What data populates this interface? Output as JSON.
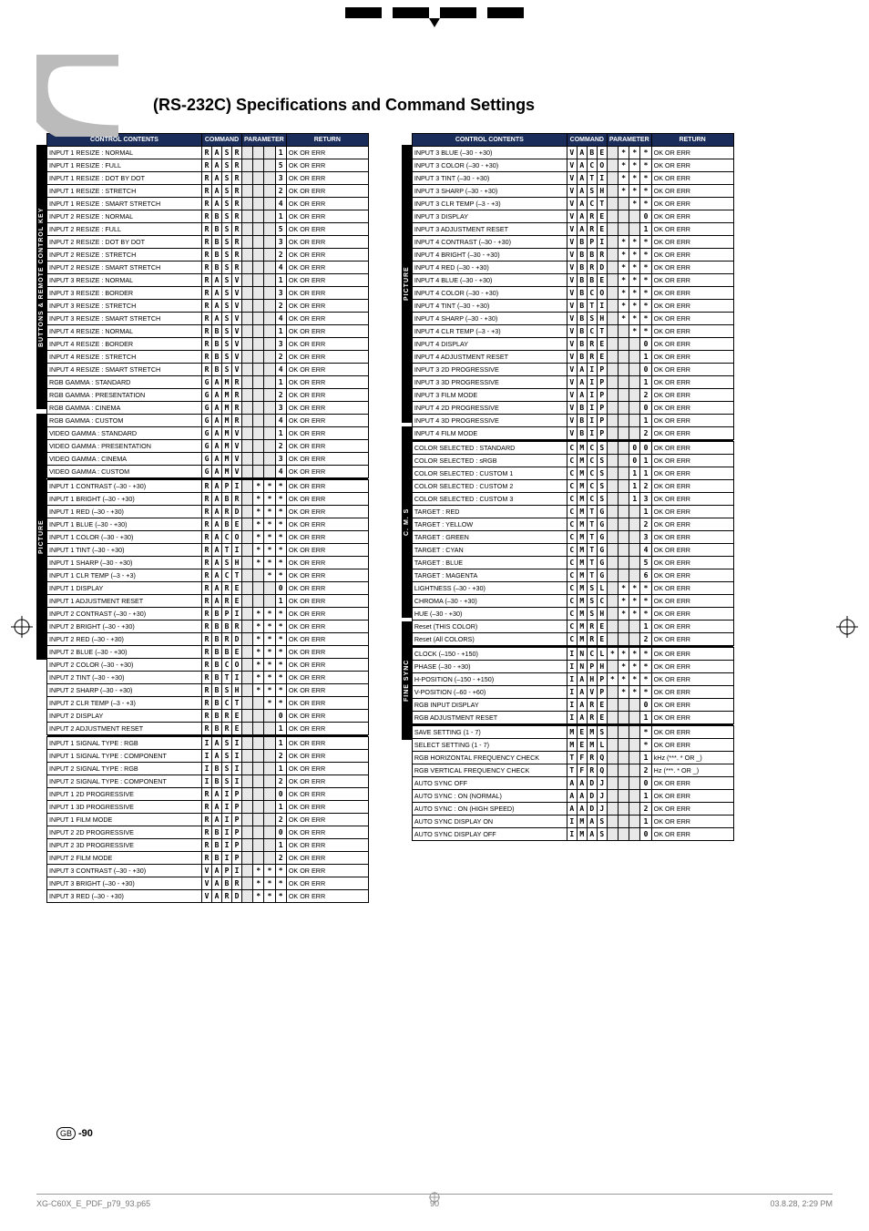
{
  "title": "(RS-232C) Specifications and Command Settings",
  "page_num": "-90",
  "gb": "GB",
  "footer_file": "XG-C60X_E_PDF_p79_93.p65",
  "footer_page": "90",
  "footer_date": "03.8.28, 2:29 PM",
  "hdr": {
    "control": "CONTROL CONTENTS",
    "command": "COMMAND",
    "param": "PARAMETER",
    "return": "RETURN"
  },
  "vlabels": {
    "l1": "BUTTONS & REMOTE CONTROL KEY",
    "l2a": "PICTURE",
    "l2b": "C. M. S",
    "l2c": "FINE SYNC",
    "l2d": ""
  },
  "table1": [
    [
      "INPUT 1 RESIZE : NORMAL",
      "R",
      "A",
      "S",
      "R",
      "_",
      "_",
      "_",
      "1",
      "OK OR ERR"
    ],
    [
      "INPUT 1 RESIZE : FULL",
      "R",
      "A",
      "S",
      "R",
      "_",
      "_",
      "_",
      "5",
      "OK OR ERR"
    ],
    [
      "INPUT 1 RESIZE : DOT BY DOT",
      "R",
      "A",
      "S",
      "R",
      "_",
      "_",
      "_",
      "3",
      "OK OR ERR"
    ],
    [
      "INPUT 1 RESIZE : STRETCH",
      "R",
      "A",
      "S",
      "R",
      "_",
      "_",
      "_",
      "2",
      "OK OR ERR"
    ],
    [
      "INPUT 1 RESIZE : SMART STRETCH",
      "R",
      "A",
      "S",
      "R",
      "_",
      "_",
      "_",
      "4",
      "OK OR ERR"
    ],
    [
      "INPUT 2 RESIZE : NORMAL",
      "R",
      "B",
      "S",
      "R",
      "_",
      "_",
      "_",
      "1",
      "OK OR ERR"
    ],
    [
      "INPUT 2 RESIZE : FULL",
      "R",
      "B",
      "S",
      "R",
      "_",
      "_",
      "_",
      "5",
      "OK OR ERR"
    ],
    [
      "INPUT 2 RESIZE : DOT BY DOT",
      "R",
      "B",
      "S",
      "R",
      "_",
      "_",
      "_",
      "3",
      "OK OR ERR"
    ],
    [
      "INPUT 2 RESIZE : STRETCH",
      "R",
      "B",
      "S",
      "R",
      "_",
      "_",
      "_",
      "2",
      "OK OR ERR"
    ],
    [
      "INPUT 2 RESIZE : SMART STRETCH",
      "R",
      "B",
      "S",
      "R",
      "_",
      "_",
      "_",
      "4",
      "OK OR ERR"
    ],
    [
      "INPUT 3 RESIZE : NORMAL",
      "R",
      "A",
      "S",
      "V",
      "_",
      "_",
      "_",
      "1",
      "OK OR ERR"
    ],
    [
      "INPUT 3 RESIZE : BORDER",
      "R",
      "A",
      "S",
      "V",
      "_",
      "_",
      "_",
      "3",
      "OK OR ERR"
    ],
    [
      "INPUT 3 RESIZE : STRETCH",
      "R",
      "A",
      "S",
      "V",
      "_",
      "_",
      "_",
      "2",
      "OK OR ERR"
    ],
    [
      "INPUT 3 RESIZE : SMART STRETCH",
      "R",
      "A",
      "S",
      "V",
      "_",
      "_",
      "_",
      "4",
      "OK OR ERR"
    ],
    [
      "INPUT 4 RESIZE : NORMAL",
      "R",
      "B",
      "S",
      "V",
      "_",
      "_",
      "_",
      "1",
      "OK OR ERR"
    ],
    [
      "INPUT 4 RESIZE : BORDER",
      "R",
      "B",
      "S",
      "V",
      "_",
      "_",
      "_",
      "3",
      "OK OR ERR"
    ],
    [
      "INPUT 4 RESIZE : STRETCH",
      "R",
      "B",
      "S",
      "V",
      "_",
      "_",
      "_",
      "2",
      "OK OR ERR"
    ],
    [
      "INPUT 4 RESIZE : SMART STRETCH",
      "R",
      "B",
      "S",
      "V",
      "_",
      "_",
      "_",
      "4",
      "OK OR ERR"
    ],
    [
      "RGB GAMMA : STANDARD",
      "G",
      "A",
      "M",
      "R",
      "_",
      "_",
      "_",
      "1",
      "OK OR ERR"
    ],
    [
      "RGB GAMMA : PRESENTATION",
      "G",
      "A",
      "M",
      "R",
      "_",
      "_",
      "_",
      "2",
      "OK OR ERR"
    ],
    [
      "RGB GAMMA : CINEMA",
      "G",
      "A",
      "M",
      "R",
      "_",
      "_",
      "_",
      "3",
      "OK OR ERR"
    ],
    [
      "RGB GAMMA : CUSTOM",
      "G",
      "A",
      "M",
      "R",
      "_",
      "_",
      "_",
      "4",
      "OK OR ERR"
    ],
    [
      "VIDEO GAMMA : STANDARD",
      "G",
      "A",
      "M",
      "V",
      "_",
      "_",
      "_",
      "1",
      "OK OR ERR"
    ],
    [
      "VIDEO GAMMA : PRESENTATION",
      "G",
      "A",
      "M",
      "V",
      "_",
      "_",
      "_",
      "2",
      "OK OR ERR"
    ],
    [
      "VIDEO GAMMA : CINEMA",
      "G",
      "A",
      "M",
      "V",
      "_",
      "_",
      "_",
      "3",
      "OK OR ERR"
    ],
    [
      "VIDEO GAMMA : CUSTOM",
      "G",
      "A",
      "M",
      "V",
      "_",
      "_",
      "_",
      "4",
      "OK OR ERR"
    ],
    [
      "INPUT 1 CONTRAST (–30 - +30)",
      "R",
      "A",
      "P",
      "I",
      "_",
      "*",
      "*",
      "*",
      "OK OR ERR"
    ],
    [
      "INPUT 1 BRIGHT (–30 - +30)",
      "R",
      "A",
      "B",
      "R",
      "_",
      "*",
      "*",
      "*",
      "OK OR ERR"
    ],
    [
      "INPUT 1 RED  (–30 - +30)",
      "R",
      "A",
      "R",
      "D",
      "_",
      "*",
      "*",
      "*",
      "OK OR ERR"
    ],
    [
      "INPUT 1 BLUE (–30 - +30)",
      "R",
      "A",
      "B",
      "E",
      "_",
      "*",
      "*",
      "*",
      "OK OR ERR"
    ],
    [
      "INPUT 1 COLOR  (–30 - +30)",
      "R",
      "A",
      "C",
      "O",
      "_",
      "*",
      "*",
      "*",
      "OK OR ERR"
    ],
    [
      "INPUT 1 TINT (–30 - +30)",
      "R",
      "A",
      "T",
      "I",
      "_",
      "*",
      "*",
      "*",
      "OK OR ERR"
    ],
    [
      "INPUT 1 SHARP (–30 - +30)",
      "R",
      "A",
      "S",
      "H",
      "_",
      "*",
      "*",
      "*",
      "OK OR ERR"
    ],
    [
      "INPUT 1 CLR TEMP (–3 - +3)",
      "R",
      "A",
      "C",
      "T",
      "_",
      "_",
      "*",
      "*",
      "OK OR ERR"
    ],
    [
      "INPUT 1 DISPLAY",
      "R",
      "A",
      "R",
      "E",
      "_",
      "_",
      "_",
      "0",
      "OK OR ERR"
    ],
    [
      "INPUT 1 ADJUSTMENT RESET",
      "R",
      "A",
      "R",
      "E",
      "_",
      "_",
      "_",
      "1",
      "OK OR ERR"
    ],
    [
      "INPUT 2 CONTRAST  (–30 - +30)",
      "R",
      "B",
      "P",
      "I",
      "_",
      "*",
      "*",
      "*",
      "OK OR ERR"
    ],
    [
      "INPUT 2 BRIGHT (–30 - +30)",
      "R",
      "B",
      "B",
      "R",
      "_",
      "*",
      "*",
      "*",
      "OK OR ERR"
    ],
    [
      "INPUT 2 RED (–30 - +30)",
      "R",
      "B",
      "R",
      "D",
      "_",
      "*",
      "*",
      "*",
      "OK OR ERR"
    ],
    [
      "INPUT 2 BLUE (–30 - +30)",
      "R",
      "B",
      "B",
      "E",
      "_",
      "*",
      "*",
      "*",
      "OK OR ERR"
    ],
    [
      "INPUT 2 COLOR (–30 - +30)",
      "R",
      "B",
      "C",
      "O",
      "_",
      "*",
      "*",
      "*",
      "OK OR ERR"
    ],
    [
      "INPUT 2 TINT (–30 - +30)",
      "R",
      "B",
      "T",
      "I",
      "_",
      "*",
      "*",
      "*",
      "OK OR ERR"
    ],
    [
      "INPUT 2 SHARP (–30 - +30)",
      "R",
      "B",
      "S",
      "H",
      "_",
      "*",
      "*",
      "*",
      "OK OR ERR"
    ],
    [
      "INPUT 2 CLR TEMP (–3 - +3)",
      "R",
      "B",
      "C",
      "T",
      "_",
      "_",
      "*",
      "*",
      "OK OR ERR"
    ],
    [
      "INPUT 2 DISPLAY",
      "R",
      "B",
      "R",
      "E",
      "_",
      "_",
      "_",
      "0",
      "OK OR ERR"
    ],
    [
      "INPUT 2 ADJUSTMENT RESET",
      "R",
      "B",
      "R",
      "E",
      "_",
      "_",
      "_",
      "1",
      "OK OR ERR"
    ],
    [
      "INPUT 1 SIGNAL TYPE : RGB",
      "I",
      "A",
      "S",
      "I",
      "_",
      "_",
      "_",
      "1",
      "OK OR ERR"
    ],
    [
      "INPUT 1 SIGNAL TYPE : COMPONENT",
      "I",
      "A",
      "S",
      "I",
      "_",
      "_",
      "_",
      "2",
      "OK OR ERR"
    ],
    [
      "INPUT 2 SIGNAL TYPE : RGB",
      "I",
      "B",
      "S",
      "I",
      "_",
      "_",
      "_",
      "1",
      "OK OR ERR"
    ],
    [
      "INPUT 2 SIGNAL TYPE : COMPONENT",
      "I",
      "B",
      "S",
      "I",
      "_",
      "_",
      "_",
      "2",
      "OK OR ERR"
    ],
    [
      "INPUT 1 2D PROGRESSIVE",
      "R",
      "A",
      "I",
      "P",
      "_",
      "_",
      "_",
      "0",
      "OK OR ERR"
    ],
    [
      "INPUT 1 3D PROGRESSIVE",
      "R",
      "A",
      "I",
      "P",
      "_",
      "_",
      "_",
      "1",
      "OK OR ERR"
    ],
    [
      "INPUT 1 FILM MODE",
      "R",
      "A",
      "I",
      "P",
      "_",
      "_",
      "_",
      "2",
      "OK OR ERR"
    ],
    [
      "INPUT 2 2D PROGRESSIVE",
      "R",
      "B",
      "I",
      "P",
      "_",
      "_",
      "_",
      "0",
      "OK OR ERR"
    ],
    [
      "INPUT 2 3D PROGRESSIVE",
      "R",
      "B",
      "I",
      "P",
      "_",
      "_",
      "_",
      "1",
      "OK OR ERR"
    ],
    [
      "INPUT 2 FILM MODE",
      "R",
      "B",
      "I",
      "P",
      "_",
      "_",
      "_",
      "2",
      "OK OR ERR"
    ],
    [
      "INPUT 3 CONTRAST (–30 - +30)",
      "V",
      "A",
      "P",
      "I",
      "_",
      "*",
      "*",
      "*",
      "OK OR ERR"
    ],
    [
      "INPUT 3 BRIGHT (–30 - +30)",
      "V",
      "A",
      "B",
      "R",
      "_",
      "*",
      "*",
      "*",
      "OK OR ERR"
    ],
    [
      "INPUT 3 RED (–30 - +30)",
      "V",
      "A",
      "R",
      "D",
      "_",
      "*",
      "*",
      "*",
      "OK OR ERR"
    ]
  ],
  "seps1": [
    26,
    46
  ],
  "table2": [
    [
      "INPUT 3 BLUE (–30 - +30)",
      "V",
      "A",
      "B",
      "E",
      "_",
      "*",
      "*",
      "*",
      "OK OR ERR"
    ],
    [
      "INPUT 3 COLOR (–30 - +30)",
      "V",
      "A",
      "C",
      "O",
      "_",
      "*",
      "*",
      "*",
      "OK OR ERR"
    ],
    [
      "INPUT 3 TINT (–30 - +30)",
      "V",
      "A",
      "T",
      "I",
      "_",
      "*",
      "*",
      "*",
      "OK OR ERR"
    ],
    [
      "INPUT 3 SHARP (–30 - +30)",
      "V",
      "A",
      "S",
      "H",
      "_",
      "*",
      "*",
      "*",
      "OK OR ERR"
    ],
    [
      "INPUT 3 CLR TEMP (–3 - +3)",
      "V",
      "A",
      "C",
      "T",
      "_",
      "_",
      "*",
      "*",
      "OK OR ERR"
    ],
    [
      "INPUT 3 DISPLAY",
      "V",
      "A",
      "R",
      "E",
      "_",
      "_",
      "_",
      "0",
      "OK OR ERR"
    ],
    [
      "INPUT 3 ADJUSTMENT RESET",
      "V",
      "A",
      "R",
      "E",
      "_",
      "_",
      "_",
      "1",
      "OK OR ERR"
    ],
    [
      "INPUT 4 CONTRAST (–30 - +30)",
      "V",
      "B",
      "P",
      "I",
      "_",
      "*",
      "*",
      "*",
      "OK OR ERR"
    ],
    [
      "INPUT 4 BRIGHT (–30 - +30)",
      "V",
      "B",
      "B",
      "R",
      "_",
      "*",
      "*",
      "*",
      "OK OR ERR"
    ],
    [
      "INPUT 4 RED (–30 - +30)",
      "V",
      "B",
      "R",
      "D",
      "_",
      "*",
      "*",
      "*",
      "OK OR ERR"
    ],
    [
      "INPUT 4 BLUE (–30 - +30)",
      "V",
      "B",
      "B",
      "E",
      "_",
      "*",
      "*",
      "*",
      "OK OR ERR"
    ],
    [
      "INPUT 4 COLOR (–30 - +30)",
      "V",
      "B",
      "C",
      "O",
      "_",
      "*",
      "*",
      "*",
      "OK OR ERR"
    ],
    [
      "INPUT 4 TINT (–30 - +30)",
      "V",
      "B",
      "T",
      "I",
      "_",
      "*",
      "*",
      "*",
      "OK OR ERR"
    ],
    [
      "INPUT 4 SHARP (–30 - +30)",
      "V",
      "B",
      "S",
      "H",
      "_",
      "*",
      "*",
      "*",
      "OK OR ERR"
    ],
    [
      "INPUT 4 CLR TEMP (–3 - +3)",
      "V",
      "B",
      "C",
      "T",
      "_",
      "_",
      "*",
      "*",
      "OK OR ERR"
    ],
    [
      "INPUT 4 DISPLAY",
      "V",
      "B",
      "R",
      "E",
      "_",
      "_",
      "_",
      "0",
      "OK OR ERR"
    ],
    [
      "INPUT 4 ADJUSTMENT RESET",
      "V",
      "B",
      "R",
      "E",
      "_",
      "_",
      "_",
      "1",
      "OK OR ERR"
    ],
    [
      "INPUT 3 2D PROGRESSIVE",
      "V",
      "A",
      "I",
      "P",
      "_",
      "_",
      "_",
      "0",
      "OK OR ERR"
    ],
    [
      "INPUT 3 3D PROGRESSIVE",
      "V",
      "A",
      "I",
      "P",
      "_",
      "_",
      "_",
      "1",
      "OK OR ERR"
    ],
    [
      "INPUT 3 FILM MODE",
      "V",
      "A",
      "I",
      "P",
      "_",
      "_",
      "_",
      "2",
      "OK OR ERR"
    ],
    [
      "INPUT 4 2D PROGRESSIVE",
      "V",
      "B",
      "I",
      "P",
      "_",
      "_",
      "_",
      "0",
      "OK OR ERR"
    ],
    [
      "INPUT 4 3D PROGRESSIVE",
      "V",
      "B",
      "I",
      "P",
      "_",
      "_",
      "_",
      "1",
      "OK OR ERR"
    ],
    [
      "INPUT 4 FILM MODE",
      "V",
      "B",
      "I",
      "P",
      "_",
      "_",
      "_",
      "2",
      "OK OR ERR"
    ],
    [
      "COLOR SELECTED : STANDARD",
      "C",
      "M",
      "C",
      "S",
      "_",
      "_",
      "0",
      "0",
      "OK OR ERR"
    ],
    [
      "COLOR SELECTED : sRGB",
      "C",
      "M",
      "C",
      "S",
      "_",
      "_",
      "0",
      "1",
      "OK OR ERR"
    ],
    [
      "COLOR SELECTED : CUSTOM 1",
      "C",
      "M",
      "C",
      "S",
      "_",
      "_",
      "1",
      "1",
      "OK OR ERR"
    ],
    [
      "COLOR SELECTED : CUSTOM 2",
      "C",
      "M",
      "C",
      "S",
      "_",
      "_",
      "1",
      "2",
      "OK OR ERR"
    ],
    [
      "COLOR SELECTED : CUSTOM 3",
      "C",
      "M",
      "C",
      "S",
      "_",
      "_",
      "1",
      "3",
      "OK OR ERR"
    ],
    [
      "TARGET : RED",
      "C",
      "M",
      "T",
      "G",
      "_",
      "_",
      "_",
      "1",
      "OK OR ERR"
    ],
    [
      "TARGET : YELLOW",
      "C",
      "M",
      "T",
      "G",
      "_",
      "_",
      "_",
      "2",
      "OK OR ERR"
    ],
    [
      "TARGET : GREEN",
      "C",
      "M",
      "T",
      "G",
      "_",
      "_",
      "_",
      "3",
      "OK OR ERR"
    ],
    [
      "TARGET : CYAN",
      "C",
      "M",
      "T",
      "G",
      "_",
      "_",
      "_",
      "4",
      "OK OR ERR"
    ],
    [
      "TARGET : BLUE",
      "C",
      "M",
      "T",
      "G",
      "_",
      "_",
      "_",
      "5",
      "OK OR ERR"
    ],
    [
      "TARGET : MAGENTA",
      "C",
      "M",
      "T",
      "G",
      "_",
      "_",
      "_",
      "6",
      "OK OR ERR"
    ],
    [
      "LIGHTNESS  (–30 - +30)",
      "C",
      "M",
      "S",
      "L",
      "_",
      "*",
      "*",
      "*",
      "OK OR ERR"
    ],
    [
      "CHROMA (–30 - +30)",
      "C",
      "M",
      "S",
      "C",
      "_",
      "*",
      "*",
      "*",
      "OK OR ERR"
    ],
    [
      "HUE (–30 - +30)",
      "C",
      "M",
      "S",
      "H",
      "_",
      "*",
      "*",
      "*",
      "OK OR ERR"
    ],
    [
      "Reset (THIS COLOR)",
      "C",
      "M",
      "R",
      "E",
      "_",
      "_",
      "_",
      "1",
      "OK OR ERR"
    ],
    [
      "Reset (All COLORS)",
      "C",
      "M",
      "R",
      "E",
      "_",
      "_",
      "_",
      "2",
      "OK OR ERR"
    ],
    [
      "CLOCK (–150 - +150)",
      "I",
      "N",
      "C",
      "L",
      "*",
      "*",
      "*",
      "*",
      "OK OR ERR"
    ],
    [
      "PHASE (–30 - +30)",
      "I",
      "N",
      "P",
      "H",
      "_",
      "*",
      "*",
      "*",
      "OK OR ERR"
    ],
    [
      "H-POSITION (–150 - +150)",
      "I",
      "A",
      "H",
      "P",
      "*",
      "*",
      "*",
      "*",
      "OK OR ERR"
    ],
    [
      "V-POSITION (–60 - +60)",
      "I",
      "A",
      "V",
      "P",
      "_",
      "*",
      "*",
      "*",
      "OK OR ERR"
    ],
    [
      "RGB INPUT DISPLAY",
      "I",
      "A",
      "R",
      "E",
      "_",
      "_",
      "_",
      "0",
      "OK OR ERR"
    ],
    [
      "RGB ADJUSTMENT RESET",
      "I",
      "A",
      "R",
      "E",
      "_",
      "_",
      "_",
      "1",
      "OK OR ERR"
    ],
    [
      "SAVE SETTING (1 - 7)",
      "M",
      "E",
      "M",
      "S",
      "_",
      "_",
      "_",
      "*",
      "OK OR ERR"
    ],
    [
      "SELECT SETTING (1 - 7)",
      "M",
      "E",
      "M",
      "L",
      "_",
      "_",
      "_",
      "*",
      "OK OR ERR"
    ],
    [
      "RGB HORIZONTAL FREQUENCY CHECK",
      "T",
      "F",
      "R",
      "Q",
      "_",
      "_",
      "_",
      "1",
      "kHz (***. * OR _)"
    ],
    [
      "RGB VERTICAL FREQUENCY CHECK",
      "T",
      "F",
      "R",
      "Q",
      "_",
      "_",
      "_",
      "2",
      "Hz (***. * OR _)"
    ],
    [
      "AUTO SYNC OFF",
      "A",
      "A",
      "D",
      "J",
      "_",
      "_",
      "_",
      "0",
      "OK OR ERR"
    ],
    [
      "AUTO SYNC : ON (NORMAL)",
      "A",
      "A",
      "D",
      "J",
      "_",
      "_",
      "_",
      "1",
      "OK OR ERR"
    ],
    [
      "AUTO SYNC : ON (HIGH SPEED)",
      "A",
      "A",
      "D",
      "J",
      "_",
      "_",
      "_",
      "2",
      "OK OR ERR"
    ],
    [
      "AUTO SYNC DISPLAY ON",
      "I",
      "M",
      "A",
      "S",
      "_",
      "_",
      "_",
      "1",
      "OK OR ERR"
    ],
    [
      "AUTO SYNC DISPLAY OFF",
      "I",
      "M",
      "A",
      "S",
      "_",
      "_",
      "_",
      "0",
      "OK OR ERR"
    ]
  ],
  "seps2": [
    23,
    39,
    45
  ]
}
